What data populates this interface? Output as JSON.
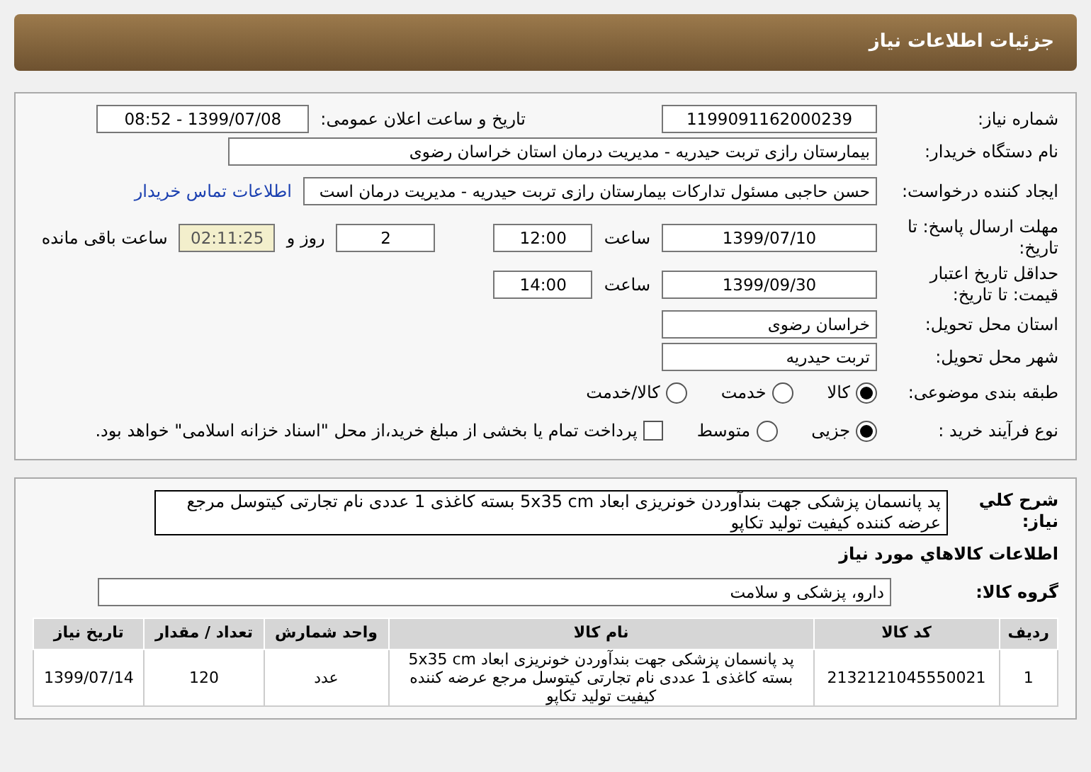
{
  "header": {
    "title": "جزئیات اطلاعات نیاز"
  },
  "need_number": {
    "label": "شماره نیاز:",
    "value": "1199091162000239"
  },
  "announce": {
    "label": "تاریخ و ساعت اعلان عمومی:",
    "value": "1399/07/08 - 08:52"
  },
  "buyer": {
    "label": "نام دستگاه خریدار:",
    "value": "بیمارستان رازی تربت حیدریه - مدیریت درمان استان خراسان رضوی"
  },
  "creator": {
    "label": "ایجاد کننده درخواست:",
    "value": "حسن حاجبی مسئول تدارکات بیمارستان رازی تربت حیدریه - مدیریت درمان است",
    "link": "اطلاعات تماس خریدار"
  },
  "deadline": {
    "label": "مهلت ارسال پاسخ: تا تاریخ:",
    "date": "1399/07/10",
    "time_label": "ساعت",
    "time": "12:00",
    "days": "2",
    "days_label": "روز و",
    "remaining": "02:11:25",
    "remaining_label": "ساعت باقی مانده"
  },
  "validity": {
    "label": "حداقل تاریخ اعتبار قیمت: تا تاریخ:",
    "date": "1399/09/30",
    "time_label": "ساعت",
    "time": "14:00"
  },
  "province": {
    "label": "استان محل تحویل:",
    "value": "خراسان رضوی"
  },
  "city": {
    "label": "شهر محل تحویل:",
    "value": "تربت حیدریه"
  },
  "category": {
    "label": "طبقه بندی موضوعی:",
    "options": [
      {
        "kind": "radio",
        "label": "کالا",
        "selected": true
      },
      {
        "kind": "radio",
        "label": "خدمت",
        "selected": false
      },
      {
        "kind": "radio",
        "label": "کالا/خدمت",
        "selected": false
      }
    ]
  },
  "process": {
    "label": "نوع فرآیند خرید :",
    "options": [
      {
        "kind": "radio",
        "label": "جزیی",
        "selected": true
      },
      {
        "kind": "radio",
        "label": "متوسط",
        "selected": false
      },
      {
        "kind": "checkbox",
        "label": "پرداخت تمام یا بخشی از مبلغ خرید،از محل \"اسناد خزانه اسلامی\" خواهد بود.",
        "checked": false
      }
    ]
  },
  "description": {
    "label": "شرح کلي نياز:",
    "value": "پد پانسمان پزشکی جهت بندآوردن خونریزی ابعاد 5x35 cm بسته کاغذی 1 عددی نام تجارتی کیتوسل مرجع عرضه کننده کیفیت تولید تکاپو"
  },
  "items_heading": "اطلاعات کالاهاي مورد نياز",
  "group": {
    "label": "گروه کالا:",
    "value": "دارو، پزشکی و سلامت"
  },
  "table": {
    "columns": [
      "ردیف",
      "کد کالا",
      "نام کالا",
      "واحد شمارش",
      "تعداد / مقدار",
      "تاریخ نیاز"
    ],
    "rows": [
      [
        "1",
        "2132121045550021",
        "پد پانسمان پزشکی جهت بندآوردن خونریزی ابعاد 5x35 cm بسته کاغذی 1 عددی نام تجارتی کیتوسل مرجع عرضه کننده کیفیت تولید تکاپو",
        "عدد",
        "120",
        "1399/07/14"
      ]
    ]
  }
}
